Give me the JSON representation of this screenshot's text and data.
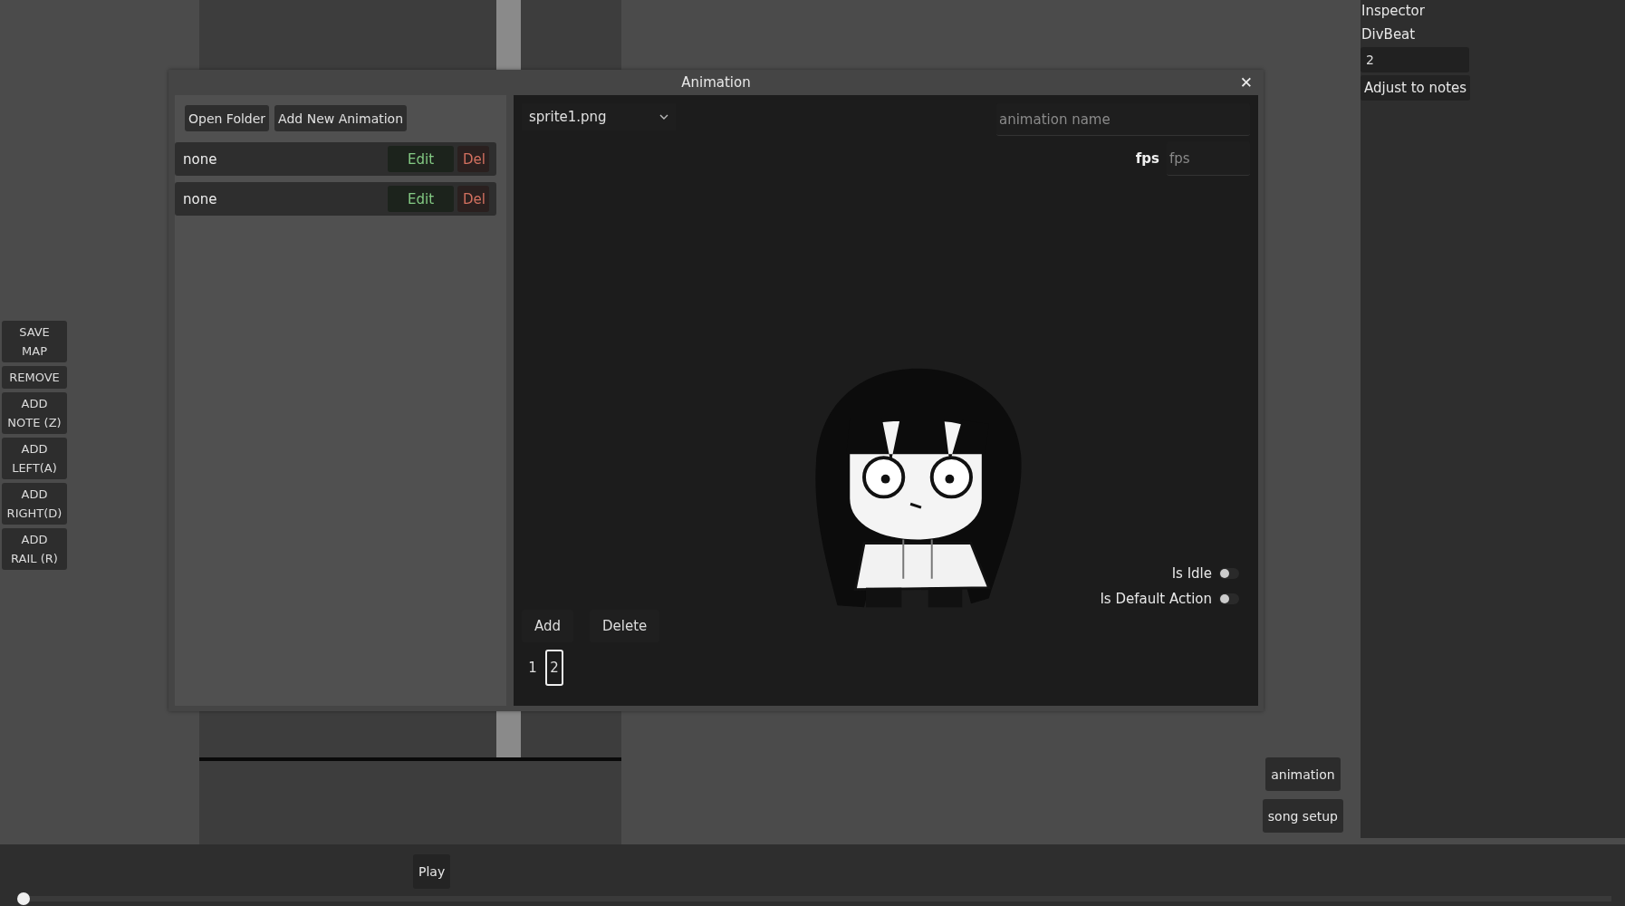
{
  "tools": [
    "SAVE\nMAP",
    "REMOVE",
    "ADD\nNOTE (Z)",
    "ADD\nLEFT(A)",
    "ADD\nRIGHT(D)",
    "ADD\nRAIL (R)"
  ],
  "side_buttons": [
    "animation",
    "song setup"
  ],
  "inspector": {
    "title": "Inspector",
    "field_label": "DivBeat",
    "field_value": "2",
    "button": "Adjust to notes"
  },
  "dialog": {
    "title": "Animation",
    "close": "✕",
    "toolbar": [
      "Open Folder",
      "Add New Animation"
    ],
    "animations": [
      {
        "name": "none",
        "edit": "Edit",
        "delete": "Del"
      },
      {
        "name": "none",
        "edit": "Edit",
        "delete": "Del"
      }
    ],
    "sprite_dropdown": "sprite1.png",
    "name_placeholder": "animation name",
    "fps_label": "fps",
    "fps_placeholder": "fps",
    "frame_buttons": [
      "Add",
      "Delete"
    ],
    "frames": [
      {
        "label": "1",
        "selected": false
      },
      {
        "label": "2",
        "selected": true
      }
    ],
    "toggles": [
      {
        "label": "Is Idle",
        "on": false
      },
      {
        "label": "Is Default Action",
        "on": false
      }
    ]
  },
  "playback": {
    "button": "Play",
    "level": 0
  }
}
